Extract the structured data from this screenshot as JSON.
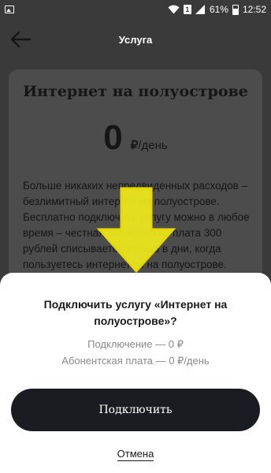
{
  "status_bar": {
    "battery": "61%",
    "time": "12:52",
    "sim": "1"
  },
  "header": {
    "title": "Услуга"
  },
  "card": {
    "title": "Интернет на полуострове",
    "price_value": "0",
    "price_currency": "₽",
    "price_period": "/день",
    "description": "Больше никаких непредвиденных расходов – безлимитный интернет на полуострове. Бесплатно подключить услугу можно в любое время – честная абонентская плата 300 рублей списывается только в дни, когда пользуетесь интернетом на полуострове."
  },
  "dialog": {
    "title": "Подключить услугу «Интернет на полуострове»?",
    "fee_connection": "Подключение — 0 ₽",
    "fee_subscription": "Абонентская плата — 0 ₽/день",
    "connect_label": "Подключить",
    "cancel_label": "Отмена"
  },
  "colors": {
    "overlay": "#3a3a3a",
    "card": "#4c4c4c",
    "button": "#1b1c21",
    "arrow_fill": "#f5ee1c"
  }
}
